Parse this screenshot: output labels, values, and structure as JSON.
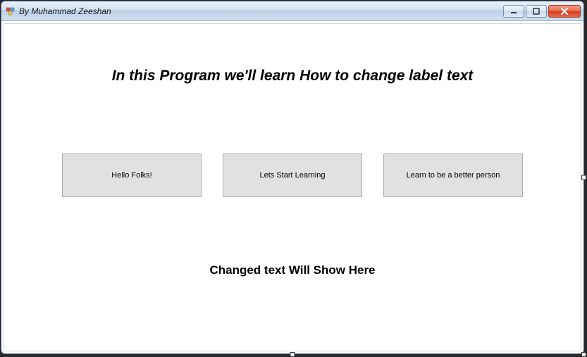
{
  "window": {
    "title": "By Muhammad Zeeshan"
  },
  "heading": "In this Program we'll learn How to change label text",
  "buttons": {
    "b1": "Hello Folks!",
    "b2": "Lets Start Learning",
    "b3": "Learn to be a better person"
  },
  "output_label": "Changed text Will Show Here"
}
